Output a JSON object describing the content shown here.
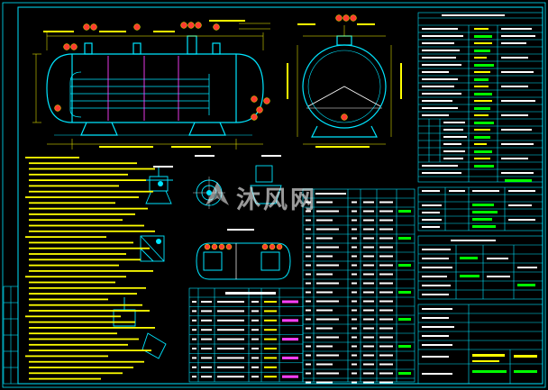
{
  "drawing": {
    "background": "#000000",
    "colors": {
      "frame": "#00e5ff",
      "vessel": "#00e5ff",
      "dim": "#ffff00",
      "notes": "#ffff00",
      "table_text": "#ffffff",
      "highlight_green": "#00ff00",
      "marker": "#ff3b30",
      "magenta": "#ff40ff"
    }
  },
  "watermark": {
    "text": "沐风网",
    "logo_icon": "mufeng-logo-icon"
  }
}
